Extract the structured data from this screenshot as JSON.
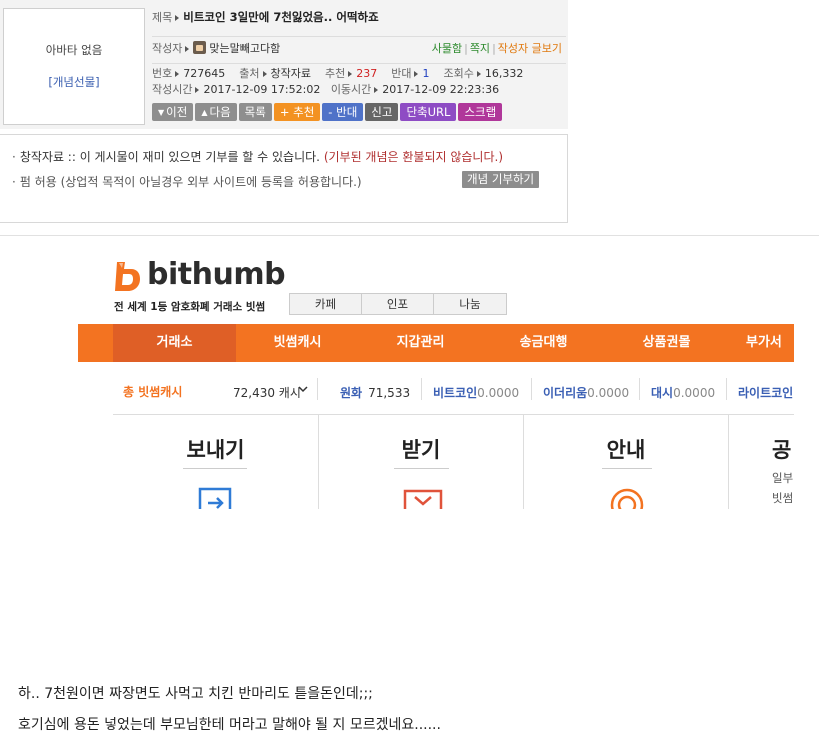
{
  "avatar": {
    "none_text": "아바타 없음",
    "gift_link": "[개념선물]"
  },
  "post": {
    "title_label": "제목",
    "title": "비트코인 3일만에 7천잃었음.. 어떡하죠",
    "author_label": "작성자",
    "author": "맞는말빼고다함",
    "author_links": [
      "사물함",
      "쪽지",
      "작성자 글보기"
    ],
    "number_label": "번호",
    "number": "727645",
    "source_label": "출처",
    "source": "창작자료",
    "upvote_label": "추천",
    "upvote": "237",
    "downvote_label": "반대",
    "downvote": "1",
    "views_label": "조회수",
    "views": "16,332",
    "created_label": "작성시간",
    "created": "2017-12-09 17:52:02",
    "moved_label": "이동시간",
    "moved": "2017-12-09 22:23:36"
  },
  "buttons": {
    "prev": "이전",
    "next": "다음",
    "list": "목록",
    "upvote": "추천",
    "downvote": "반대",
    "report": "신고",
    "short_url": "단축URL",
    "scrap": "스크랩"
  },
  "donation": {
    "line1_prefix": "창작자료 :: 이 게시물이 재미 있으면 기부를 할 수 있습니다.",
    "line1_note": "(기부된 개념은 환불되지 않습니다.)",
    "line2": "펌 허용 (상업적 목적이 아닐경우 외부 사이트에 등록을 허용합니다.)",
    "button": "개념 기부하기"
  },
  "bithumb": {
    "logo_text": "bithumb",
    "slogan": "전 세계 1등 암호화폐 거래소 빗썸",
    "top_tabs": [
      "카페",
      "인포",
      "나눔"
    ],
    "nav": [
      "거래소",
      "빗썸캐시",
      "지갑관리",
      "송금대행",
      "상품권몰",
      "부가서"
    ],
    "balance_label": "총 빗썸캐시",
    "balance_value": "72,430 캐시",
    "currencies": [
      {
        "name": "원화",
        "value": "71,533"
      },
      {
        "name": "비트코인",
        "value": "0.0000"
      },
      {
        "name": "이더리움",
        "value": "0.0000"
      },
      {
        "name": "대시",
        "value": "0.0000"
      },
      {
        "name": "라이트코인",
        "value": ""
      }
    ],
    "cards": [
      "보내기",
      "받기",
      "안내"
    ],
    "side_title": "공",
    "side_lines": [
      "일부",
      "빗썸"
    ],
    "colors": {
      "brand": "#f37321",
      "nav_active": "#df5f26",
      "currency": "#3a5fb4"
    }
  },
  "body_text": [
    "하.. 7천원이면 짜장면도 사먹고 치킨 반마리도 튿을돈인데;;;",
    "호기심에 용돈 넣었는데 부모님한테 머라고 말해야 될 지 모르겠네요......"
  ]
}
